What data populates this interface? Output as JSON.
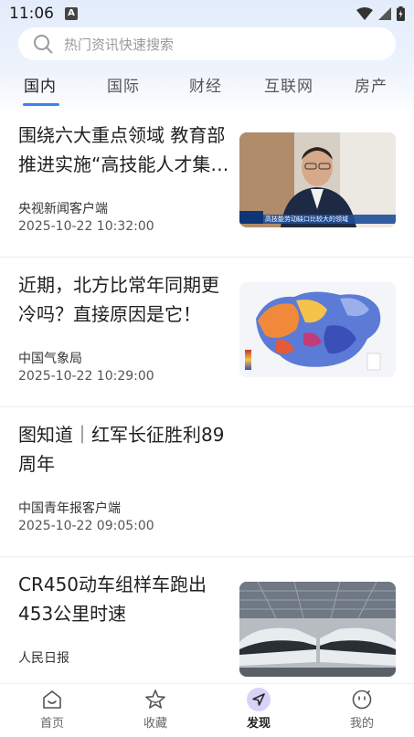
{
  "status_bar": {
    "time": "11:06",
    "indicator": "A"
  },
  "search": {
    "placeholder": "热门资讯快速搜索"
  },
  "tabs": [
    "国内",
    "国际",
    "财经",
    "互联网",
    "房产"
  ],
  "active_tab": "国内",
  "accent_color": "#3b82f6",
  "news": [
    {
      "title": "围绕六大重点领域 教育部推进实施“高技能人才集…",
      "source": "央视新闻客户端",
      "time": "2025-10-22 10:32:00",
      "thumb_caption": "高技能劳动缺口比较大的领域"
    },
    {
      "title": "近期，北方比常年同期更冷吗？直接原因是它！",
      "source": "中国气象局",
      "time": "2025-10-22 10:29:00"
    },
    {
      "title": "图知道｜红军长征胜利89周年",
      "source": "中国青年报客户端",
      "time": "2025-10-22 09:05:00"
    },
    {
      "title": "CR450动车组样车跑出453公里时速",
      "source": "人民日报",
      "time": ""
    }
  ],
  "bottom_nav": [
    {
      "label": "首页",
      "icon": "home-icon"
    },
    {
      "label": "收藏",
      "icon": "star-icon"
    },
    {
      "label": "发现",
      "icon": "compass-icon"
    },
    {
      "label": "我的",
      "icon": "profile-icon"
    }
  ],
  "active_nav": "发现"
}
